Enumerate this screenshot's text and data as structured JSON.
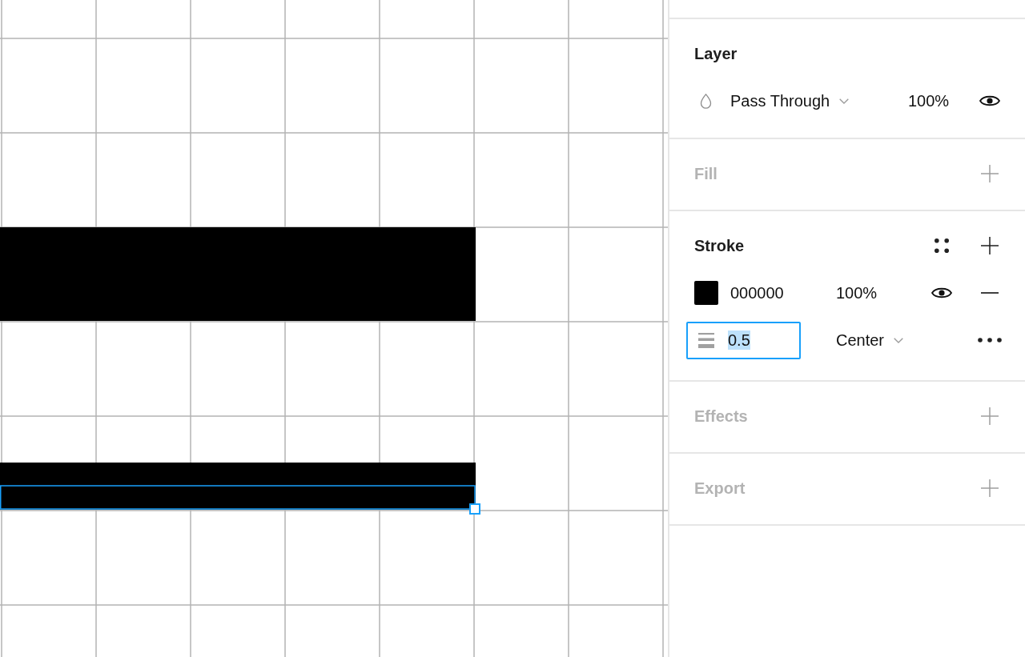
{
  "canvas": {
    "shapes": [
      {
        "selected": false
      },
      {
        "selected": true
      }
    ]
  },
  "panel": {
    "sections": [
      {
        "kind": "layer",
        "title": "Layer",
        "active": true,
        "blend_mode": "Pass Through",
        "opacity": "100%",
        "visible": true
      },
      {
        "kind": "empty",
        "title": "Fill",
        "active": false
      },
      {
        "kind": "stroke",
        "title": "Stroke",
        "active": true,
        "paints": [
          {
            "hex": "000000",
            "color": "#000000",
            "opacity": "100%",
            "visible": true
          }
        ],
        "weight": {
          "value": "0.5",
          "focused": true
        },
        "align": "Center"
      },
      {
        "kind": "empty",
        "title": "Effects",
        "active": false
      },
      {
        "kind": "empty",
        "title": "Export",
        "active": false
      }
    ]
  }
}
